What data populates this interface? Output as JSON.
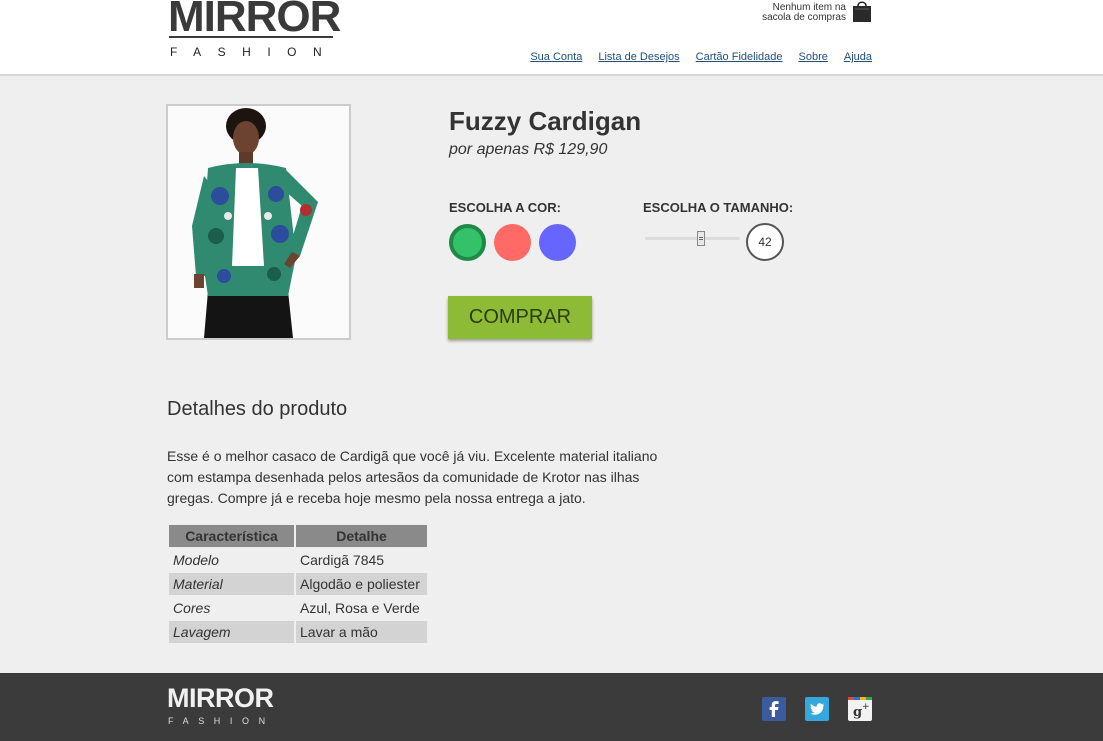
{
  "header": {
    "logo_main": "MIRROR",
    "logo_sub": "FASHION",
    "cart_line1": "Nenhum item na",
    "cart_line2": "sacola de compras",
    "nav": [
      "Sua Conta",
      "Lista de Desejos",
      "Cartão Fidelidade",
      "Sobre",
      "Ajuda"
    ]
  },
  "product": {
    "title": "Fuzzy Cardigan",
    "price": "por apenas R$ 129,90",
    "color_label": "ESCOLHA A COR:",
    "size_label": "ESCOLHA O TAMANHO:",
    "colors": [
      "#33c26a",
      "#ff6a66",
      "#6666ff"
    ],
    "selected_color": "#33c26a",
    "size_value": "42",
    "buy_label": "COMPRAR"
  },
  "details": {
    "title": "Detalhes do produto",
    "text": "Esse é o melhor casaco de Cardigã que você já viu. Excelente material italiano com estampa desenhada pelos artesãos da comunidade de Krotor nas ilhas gregas. Compre já e receba hoje mesmo pela nossa entrega a jato.",
    "table_headers": [
      "Característica",
      "Detalhe"
    ],
    "rows": [
      [
        "Modelo",
        "Cardigã 7845"
      ],
      [
        "Material",
        "Algodão e poliester"
      ],
      [
        "Cores",
        "Azul, Rosa e Verde"
      ],
      [
        "Lavagem",
        "Lavar a mão"
      ]
    ]
  },
  "footer": {
    "logo_main": "MIRROR",
    "logo_sub": "FASHION",
    "social": [
      "facebook-icon",
      "twitter-icon",
      "google-plus-icon"
    ]
  }
}
